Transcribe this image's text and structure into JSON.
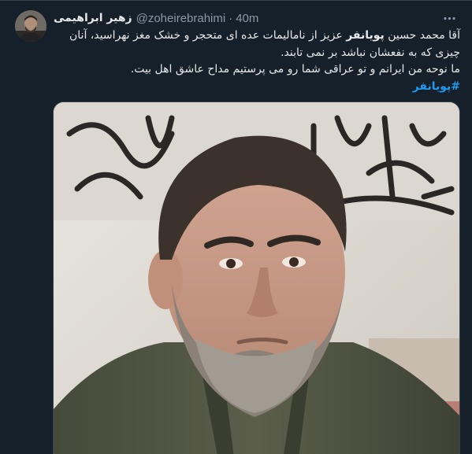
{
  "tweet": {
    "display_name": "زهیر ابراهیمی",
    "handle": "@zoheirebrahimi",
    "separator": "·",
    "time": "40m",
    "text": {
      "line1_pre": "آقا محمد حسین ",
      "mention": "پویانفر",
      "line1_post": " عزیز از نامالیمات عده ای متحجر و خشک مغز نهراسید، آنان",
      "line2": "چیزی که به نفعشان نباشد بر نمی تابند.",
      "line3": "ما نوحه من ایرانم و تو عراقی شما رو می پرستیم مداح عاشق اهل بیت.",
      "hashtag": "#پویانفر"
    }
  },
  "icons": {
    "more": "more-horizontal-icon"
  },
  "colors": {
    "background": "#15202b",
    "text": "#e7e9ea",
    "secondary": "#8b98a5",
    "link": "#1d9bf0",
    "border": "#38444d"
  }
}
